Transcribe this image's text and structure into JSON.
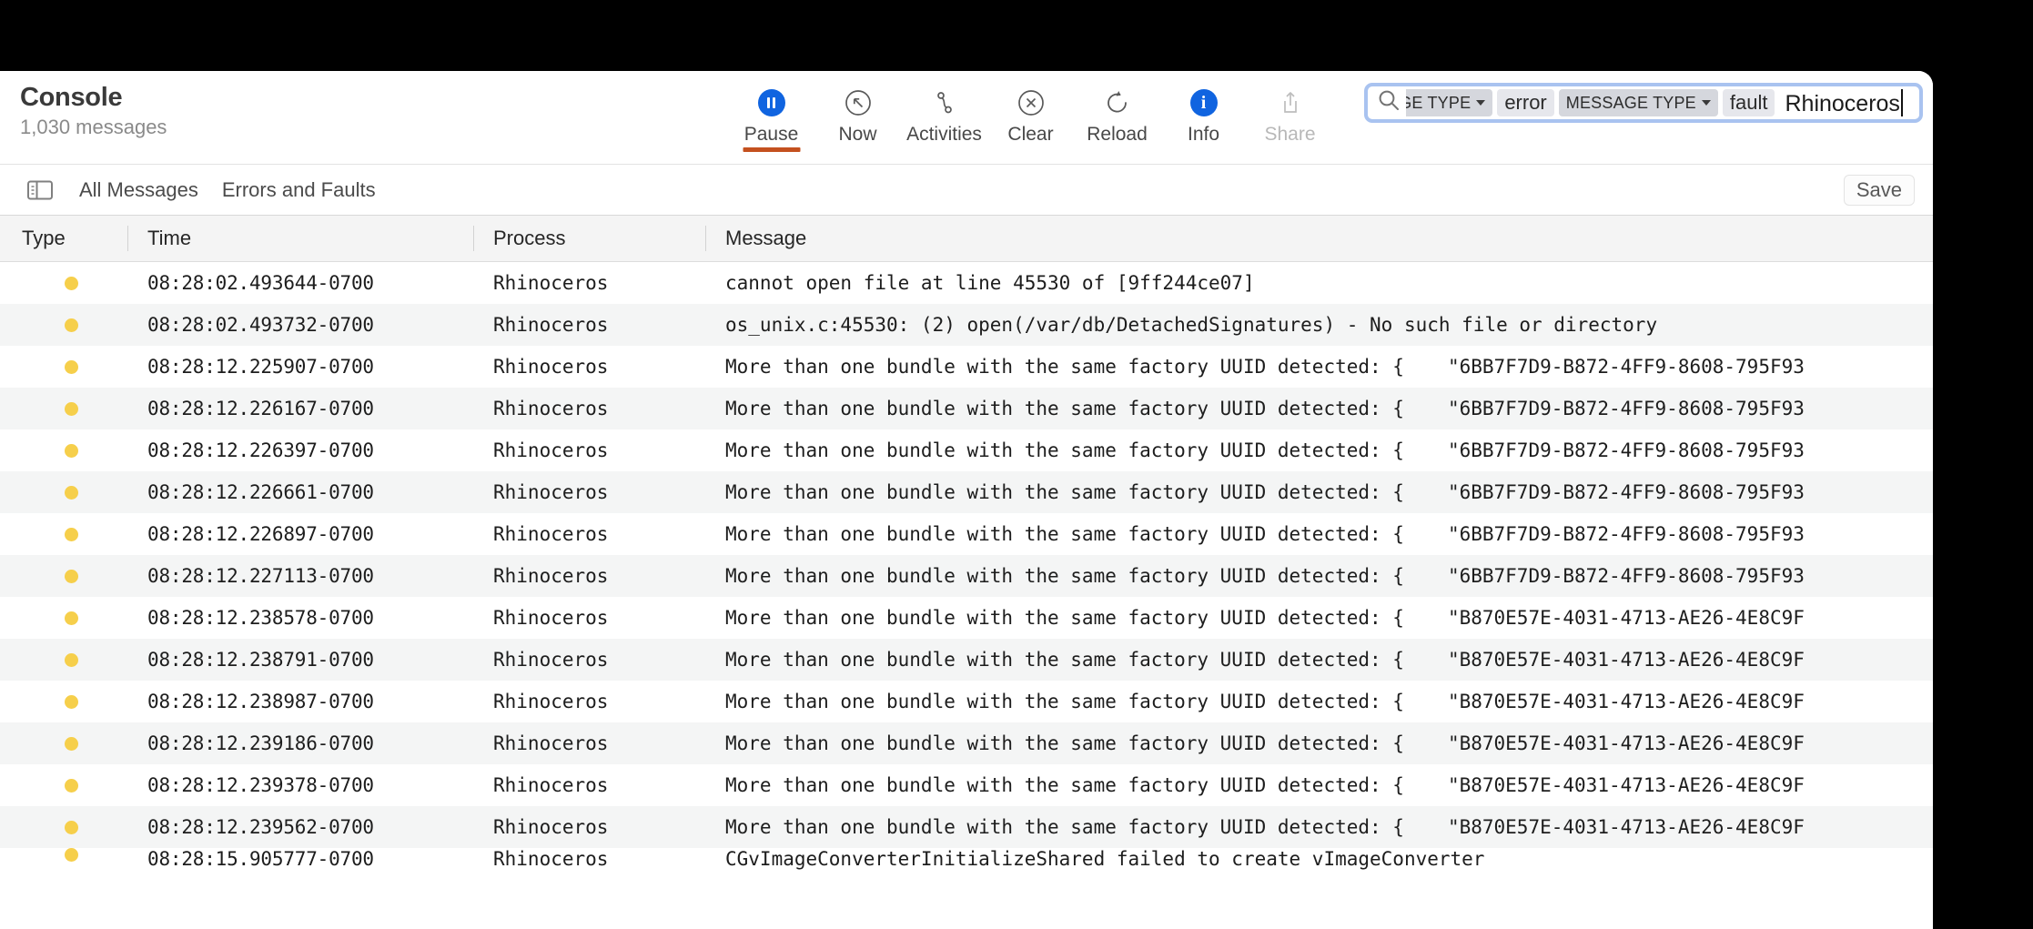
{
  "window": {
    "title": "Console",
    "message_count": "1,030 messages"
  },
  "toolbar": {
    "buttons": [
      {
        "label": "Pause",
        "icon": "pause-icon",
        "active": true,
        "disabled": false
      },
      {
        "label": "Now",
        "icon": "now-arrow-icon",
        "active": false,
        "disabled": false
      },
      {
        "label": "Activities",
        "icon": "activities-icon",
        "active": false,
        "disabled": false
      },
      {
        "label": "Clear",
        "icon": "clear-x-icon",
        "active": false,
        "disabled": false
      },
      {
        "label": "Reload",
        "icon": "reload-icon",
        "active": false,
        "disabled": false
      },
      {
        "label": "Info",
        "icon": "info-icon",
        "active": false,
        "disabled": false
      },
      {
        "label": "Share",
        "icon": "share-icon",
        "active": false,
        "disabled": true
      }
    ],
    "accent_color": "#c4511f",
    "blue_color": "#1064e0"
  },
  "search": {
    "icon": "search-icon",
    "tokens": [
      {
        "key": "AGE TYPE",
        "value": "error",
        "clipped": true
      },
      {
        "key": "MESSAGE TYPE",
        "value": "fault",
        "clipped": false
      }
    ],
    "typed_text": "Rhinoceros",
    "focus_ring_color": "#a9c3f0"
  },
  "filter_bar": {
    "sidebar_toggle_icon": "sidebar-toggle-icon",
    "items": [
      "All Messages",
      "Errors and Faults"
    ],
    "save_label": "Save"
  },
  "table": {
    "columns": [
      "Type",
      "Time",
      "Process",
      "Message"
    ],
    "rows": [
      {
        "type": "yellow",
        "time": "08:28:02.493644-0700",
        "process": "Rhinoceros",
        "message": "cannot open file at line 45530 of [9ff244ce07]",
        "uuid": ""
      },
      {
        "type": "yellow",
        "time": "08:28:02.493732-0700",
        "process": "Rhinoceros",
        "message": "os_unix.c:45530: (2) open(/var/db/DetachedSignatures) - No such file or directory",
        "uuid": ""
      },
      {
        "type": "yellow",
        "time": "08:28:12.225907-0700",
        "process": "Rhinoceros",
        "message": "More than one bundle with the same factory UUID detected: {",
        "uuid": "\"6BB7F7D9-B872-4FF9-8608-795F93"
      },
      {
        "type": "yellow",
        "time": "08:28:12.226167-0700",
        "process": "Rhinoceros",
        "message": "More than one bundle with the same factory UUID detected: {",
        "uuid": "\"6BB7F7D9-B872-4FF9-8608-795F93"
      },
      {
        "type": "yellow",
        "time": "08:28:12.226397-0700",
        "process": "Rhinoceros",
        "message": "More than one bundle with the same factory UUID detected: {",
        "uuid": "\"6BB7F7D9-B872-4FF9-8608-795F93"
      },
      {
        "type": "yellow",
        "time": "08:28:12.226661-0700",
        "process": "Rhinoceros",
        "message": "More than one bundle with the same factory UUID detected: {",
        "uuid": "\"6BB7F7D9-B872-4FF9-8608-795F93"
      },
      {
        "type": "yellow",
        "time": "08:28:12.226897-0700",
        "process": "Rhinoceros",
        "message": "More than one bundle with the same factory UUID detected: {",
        "uuid": "\"6BB7F7D9-B872-4FF9-8608-795F93"
      },
      {
        "type": "yellow",
        "time": "08:28:12.227113-0700",
        "process": "Rhinoceros",
        "message": "More than one bundle with the same factory UUID detected: {",
        "uuid": "\"6BB7F7D9-B872-4FF9-8608-795F93"
      },
      {
        "type": "yellow",
        "time": "08:28:12.238578-0700",
        "process": "Rhinoceros",
        "message": "More than one bundle with the same factory UUID detected: {",
        "uuid": "\"B870E57E-4031-4713-AE26-4E8C9F"
      },
      {
        "type": "yellow",
        "time": "08:28:12.238791-0700",
        "process": "Rhinoceros",
        "message": "More than one bundle with the same factory UUID detected: {",
        "uuid": "\"B870E57E-4031-4713-AE26-4E8C9F"
      },
      {
        "type": "yellow",
        "time": "08:28:12.238987-0700",
        "process": "Rhinoceros",
        "message": "More than one bundle with the same factory UUID detected: {",
        "uuid": "\"B870E57E-4031-4713-AE26-4E8C9F"
      },
      {
        "type": "yellow",
        "time": "08:28:12.239186-0700",
        "process": "Rhinoceros",
        "message": "More than one bundle with the same factory UUID detected: {",
        "uuid": "\"B870E57E-4031-4713-AE26-4E8C9F"
      },
      {
        "type": "yellow",
        "time": "08:28:12.239378-0700",
        "process": "Rhinoceros",
        "message": "More than one bundle with the same factory UUID detected: {",
        "uuid": "\"B870E57E-4031-4713-AE26-4E8C9F"
      },
      {
        "type": "yellow",
        "time": "08:28:12.239562-0700",
        "process": "Rhinoceros",
        "message": "More than one bundle with the same factory UUID detected: {",
        "uuid": "\"B870E57E-4031-4713-AE26-4E8C9F"
      },
      {
        "type": "yellow",
        "time": "08:28:15.905777-0700",
        "process": "Rhinoceros",
        "message": "CGvImageConverterInitializeShared failed to create vImageConverter",
        "uuid": ""
      }
    ],
    "type_dot_color": "#f6cf4b"
  }
}
